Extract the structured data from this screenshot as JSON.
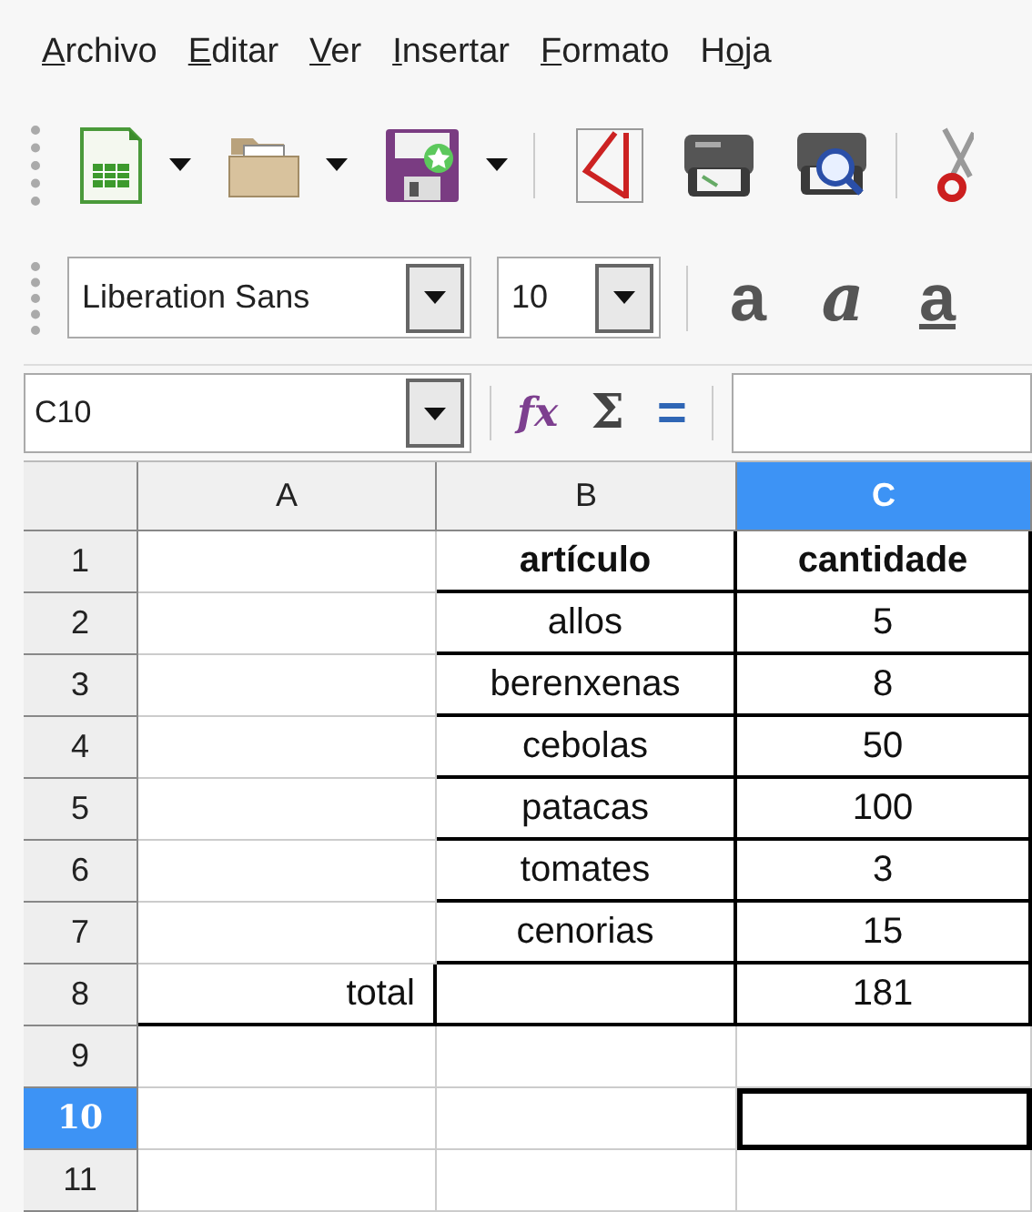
{
  "menu": [
    {
      "key": "A",
      "rest": "rchivo"
    },
    {
      "key": "E",
      "rest": "ditar"
    },
    {
      "key": "V",
      "rest": "er"
    },
    {
      "key": "I",
      "rest": "nsertar"
    },
    {
      "key": "F",
      "rest": "ormato"
    },
    {
      "pre": "H",
      "key": "o",
      "rest": "ja"
    }
  ],
  "standard_toolbar": [
    {
      "kind": "new",
      "dropdown": true
    },
    {
      "kind": "open",
      "dropdown": true
    },
    {
      "kind": "save",
      "dropdown": true
    },
    {
      "kind": "separator"
    },
    {
      "kind": "pdf"
    },
    {
      "kind": "print"
    },
    {
      "kind": "preview"
    },
    {
      "kind": "separator"
    },
    {
      "kind": "cut"
    }
  ],
  "formatting_toolbar": {
    "font_name": "Liberation Sans",
    "font_size": "10",
    "buttons": [
      {
        "kind": "bold",
        "glyph": "a"
      },
      {
        "kind": "italic",
        "glyph": "a"
      },
      {
        "kind": "underline",
        "glyph": "a"
      }
    ]
  },
  "formula_bar": {
    "name_box": "C10",
    "buttons": [
      {
        "kind": "function",
        "glyph": "fx"
      },
      {
        "kind": "sum",
        "glyph": "Σ"
      },
      {
        "kind": "formula",
        "glyph": "="
      }
    ]
  },
  "columns": [
    {
      "label": "A",
      "selected": false
    },
    {
      "label": "B",
      "selected": false
    },
    {
      "label": "C",
      "selected": true
    }
  ],
  "rows": [
    {
      "header": "1",
      "selected": false,
      "cells": [
        {
          "text": "",
          "border": false
        },
        {
          "text": "artículo",
          "border": true,
          "bold": true,
          "align_right": false
        },
        {
          "text": "cantidade",
          "border": true,
          "bold": true,
          "align_right": false
        }
      ]
    },
    {
      "header": "2",
      "selected": false,
      "cells": [
        {
          "text": "",
          "border": false
        },
        {
          "text": "allos",
          "border": true,
          "bold": false,
          "align_right": false
        },
        {
          "text": "5",
          "border": true,
          "bold": false,
          "align_right": false
        }
      ]
    },
    {
      "header": "3",
      "selected": false,
      "cells": [
        {
          "text": "",
          "border": false
        },
        {
          "text": "berenxenas",
          "border": true,
          "bold": false,
          "align_right": false
        },
        {
          "text": "8",
          "border": true,
          "bold": false,
          "align_right": false
        }
      ]
    },
    {
      "header": "4",
      "selected": false,
      "cells": [
        {
          "text": "",
          "border": false
        },
        {
          "text": "cebolas",
          "border": true,
          "bold": false,
          "align_right": false
        },
        {
          "text": "50",
          "border": true,
          "bold": false,
          "align_right": false
        }
      ]
    },
    {
      "header": "5",
      "selected": false,
      "cells": [
        {
          "text": "",
          "border": false
        },
        {
          "text": "patacas",
          "border": true,
          "bold": false,
          "align_right": false
        },
        {
          "text": "100",
          "border": true,
          "bold": false,
          "align_right": false
        }
      ]
    },
    {
      "header": "6",
      "selected": false,
      "cells": [
        {
          "text": "",
          "border": false
        },
        {
          "text": "tomates",
          "border": true,
          "bold": false,
          "align_right": false
        },
        {
          "text": "3",
          "border": true,
          "bold": false,
          "align_right": false
        }
      ]
    },
    {
      "header": "7",
      "selected": false,
      "cells": [
        {
          "text": "",
          "border": false
        },
        {
          "text": "cenorias",
          "border": true,
          "bold": false,
          "align_right": false
        },
        {
          "text": "15",
          "border": true,
          "bold": false,
          "align_right": false
        }
      ]
    },
    {
      "header": "8",
      "selected": false,
      "cells": [
        {
          "text": "total",
          "border": true,
          "bold": false,
          "align_right": true
        },
        {
          "text": "",
          "border": true
        },
        {
          "text": "181",
          "border": true,
          "bold": false,
          "align_right": false
        }
      ]
    },
    {
      "header": "9",
      "selected": false,
      "cells": [
        {
          "text": "",
          "border": false
        },
        {
          "text": "",
          "border": false
        },
        {
          "text": "",
          "border": false
        }
      ]
    },
    {
      "header": "10",
      "selected": true,
      "cells": [
        {
          "text": "",
          "border": false
        },
        {
          "text": "",
          "border": false
        },
        {
          "text": "",
          "border": false,
          "cursor": true
        }
      ]
    },
    {
      "header": "11",
      "selected": false,
      "cells": [
        {
          "text": "",
          "border": false
        },
        {
          "text": "",
          "border": false
        },
        {
          "text": "",
          "border": false
        }
      ]
    }
  ]
}
